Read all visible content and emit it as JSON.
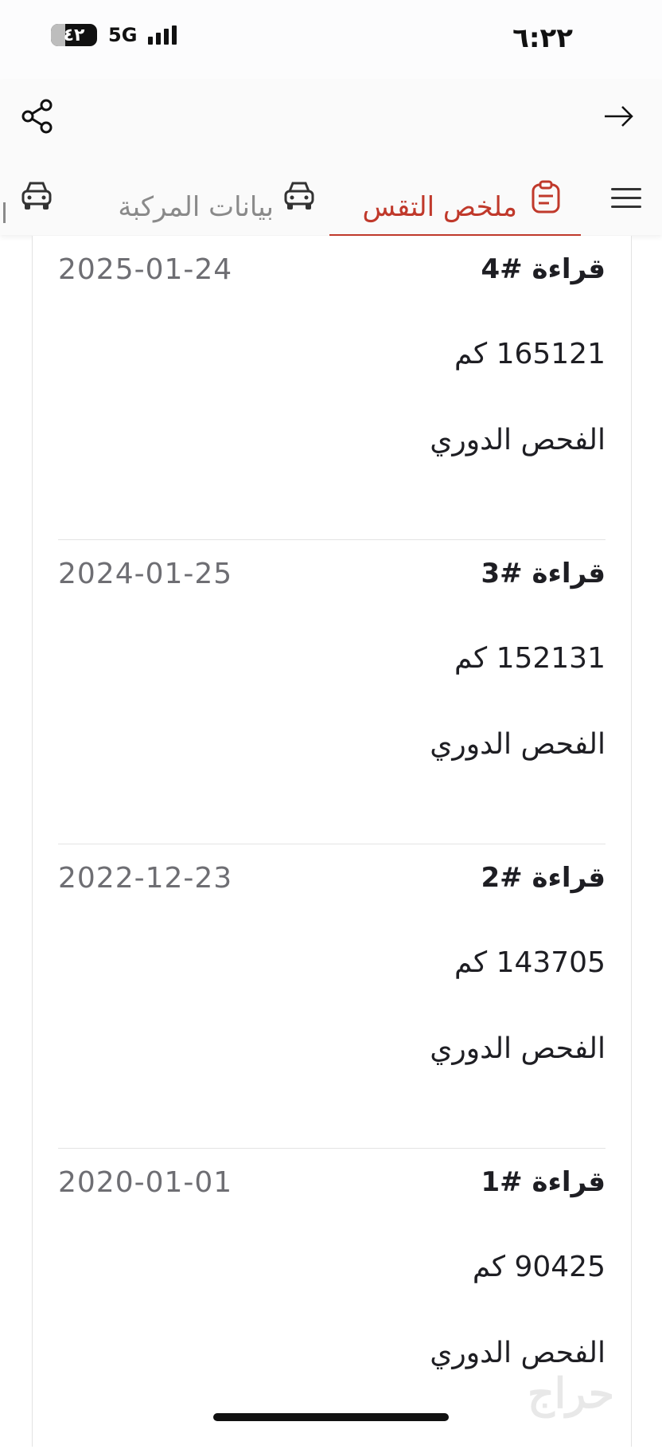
{
  "status_bar": {
    "time": "٦:٢٢",
    "battery": "٤٢",
    "network": "5G"
  },
  "header": {
    "share_icon": "share-icon",
    "back_icon": "arrow-right-icon"
  },
  "tabs": [
    {
      "label": "ملخص التقس",
      "icon": "clipboard-icon",
      "active": true
    },
    {
      "label": "بيانات المركبة",
      "icon": "car-icon",
      "active": false
    }
  ],
  "readings": [
    {
      "title": "قراءة #4",
      "date": "2025-01-24",
      "km": "165121 كم",
      "type": "الفحص الدوري"
    },
    {
      "title": "قراءة #3",
      "date": "2024-01-25",
      "km": "152131 كم",
      "type": "الفحص الدوري"
    },
    {
      "title": "قراءة #2",
      "date": "2022-12-23",
      "km": "143705 كم",
      "type": "الفحص الدوري"
    },
    {
      "title": "قراءة #1",
      "date": "2020-01-01",
      "km": "90425 كم",
      "type": "الفحص الدوري"
    }
  ],
  "watermark": "حراج",
  "colors": {
    "accent": "#c0392b"
  }
}
